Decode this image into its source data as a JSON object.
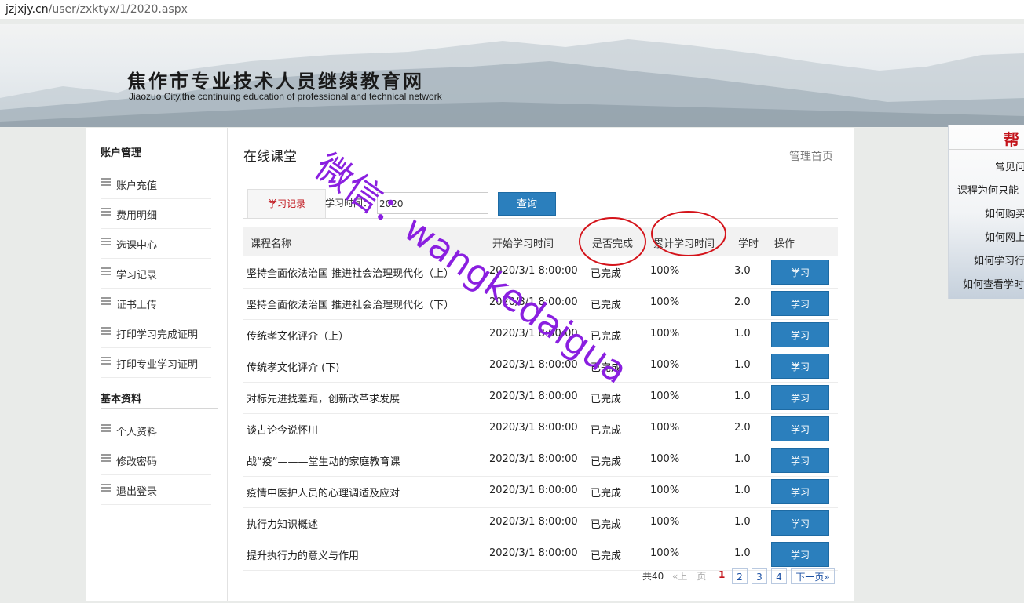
{
  "url": {
    "domain": "jzjxjy.cn",
    "path": "/user/zxktyx/1/2020.aspx"
  },
  "banner": {
    "title_cn": "焦作市专业技术人员继续教育网",
    "title_en": "Jiaozuo City,the continuing education of professional and technical network"
  },
  "sidebar": {
    "sections": [
      {
        "title": "账户管理",
        "items": [
          "账户充值",
          "费用明细",
          "选课中心",
          "学习记录",
          "证书上传",
          "打印学习完成证明",
          "打印专业学习证明"
        ]
      },
      {
        "title": "基本资料",
        "items": [
          "个人资料",
          "修改密码",
          "退出登录"
        ]
      }
    ]
  },
  "main": {
    "title": "在线课堂",
    "home_link": "管理首页",
    "tab_label": "学习记录",
    "filter_label": "学习时间：",
    "year_value": "2020",
    "query_button": "查询",
    "columns": [
      "课程名称",
      "开始学习时间",
      "是否完成",
      "累计学习时间",
      "学时",
      "操作"
    ],
    "rows": [
      {
        "name": "坚持全面依法治国 推进社会治理现代化（上）",
        "start": "2020/3/1 8:00:00",
        "done": "已完成",
        "progress": "100%",
        "hours": "3.0",
        "action": "学习"
      },
      {
        "name": "坚持全面依法治国 推进社会治理现代化（下）",
        "start": "2020/3/1 8:00:00",
        "done": "已完成",
        "progress": "100%",
        "hours": "2.0",
        "action": "学习"
      },
      {
        "name": "传统孝文化评介（上）",
        "start": "2020/3/1 8:00:00",
        "done": "已完成",
        "progress": "100%",
        "hours": "1.0",
        "action": "学习"
      },
      {
        "name": "传统孝文化评介 (下)",
        "start": "2020/3/1 8:00:00",
        "done": "已完成",
        "progress": "100%",
        "hours": "1.0",
        "action": "学习"
      },
      {
        "name": "对标先进找差距，创新改革求发展",
        "start": "2020/3/1 8:00:00",
        "done": "已完成",
        "progress": "100%",
        "hours": "1.0",
        "action": "学习"
      },
      {
        "name": "谈古论今说怀川",
        "start": "2020/3/1 8:00:00",
        "done": "已完成",
        "progress": "100%",
        "hours": "2.0",
        "action": "学习"
      },
      {
        "name": "战“疫”———堂生动的家庭教育课",
        "start": "2020/3/1 8:00:00",
        "done": "已完成",
        "progress": "100%",
        "hours": "1.0",
        "action": "学习"
      },
      {
        "name": "疫情中医护人员的心理调适及应对",
        "start": "2020/3/1 8:00:00",
        "done": "已完成",
        "progress": "100%",
        "hours": "1.0",
        "action": "学习"
      },
      {
        "name": "执行力知识概述",
        "start": "2020/3/1 8:00:00",
        "done": "已完成",
        "progress": "100%",
        "hours": "1.0",
        "action": "学习"
      },
      {
        "name": "提升执行力的意义与作用",
        "start": "2020/3/1 8:00:00",
        "done": "已完成",
        "progress": "100%",
        "hours": "1.0",
        "action": "学习"
      }
    ],
    "pager": {
      "total": "共40",
      "prev": "«上一页",
      "current": "1",
      "pages": [
        "2",
        "3",
        "4"
      ],
      "next": "下一页»"
    }
  },
  "help": {
    "title": "帮",
    "items": [
      "常见问",
      "课程为何只能",
      "如何购买",
      "如何网上",
      "如何学习行",
      "如何查看学时"
    ]
  },
  "watermark": {
    "text": "微信：wangkedaigua",
    "color": "#8a1fe0",
    "circle_color": "#d4131a"
  }
}
